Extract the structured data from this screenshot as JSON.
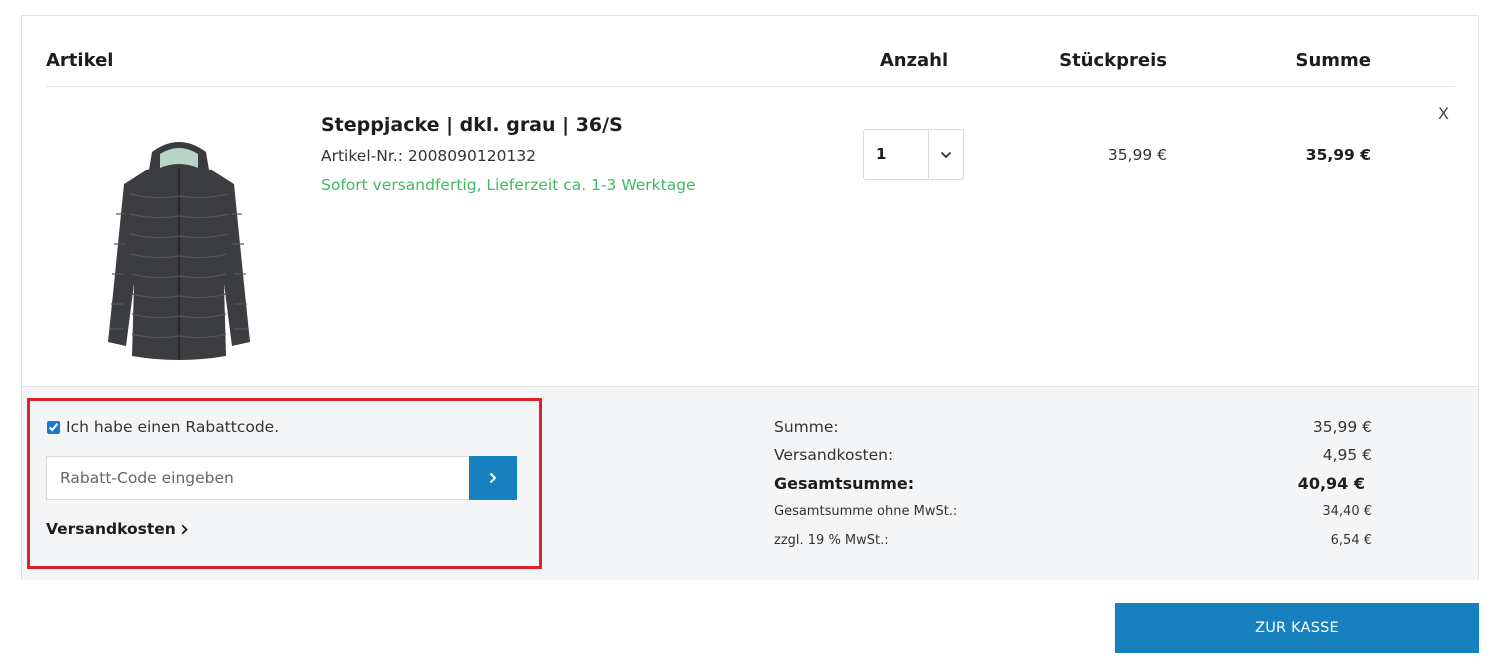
{
  "table_header": {
    "artikel": "Artikel",
    "anzahl": "Anzahl",
    "stueckpreis": "Stückpreis",
    "summe": "Summe"
  },
  "item": {
    "name": "Steppjacke | dkl. grau | 36/S",
    "sku": "Artikel-Nr.: 2008090120132",
    "availability": "Sofort versandfertig, Lieferzeit ca. 1-3 Werktage",
    "quantity": "1",
    "unit_price": "35,99 €",
    "line_total": "35,99 €",
    "remove_label": "X",
    "image_icon": "quilted-jacket-image"
  },
  "coupon": {
    "checkbox_label": "Ich habe einen Rabattcode.",
    "checked": true,
    "placeholder": "Rabatt-Code eingeben",
    "submit_icon": "chevron-right-icon"
  },
  "shipping_link": "Versandkosten",
  "totals": {
    "subtotal_label": "Summe:",
    "subtotal_value": "35,99 €",
    "shipping_label": "Versandkosten:",
    "shipping_value": "4,95 €",
    "grand_total_label": "Gesamtsumme:",
    "grand_total_value": "40,94 €",
    "net_label": "Gesamtsumme ohne MwSt.:",
    "net_value": "34,40 €",
    "vat_label": "zzgl. 19 % MwSt.:",
    "vat_value": "6,54 €"
  },
  "checkout_button": "ZUR KASSE",
  "colors": {
    "accent": "#1781c0",
    "availability": "#3fba62",
    "highlight": "#e0222b",
    "footer_bg": "#f4f5f7"
  }
}
